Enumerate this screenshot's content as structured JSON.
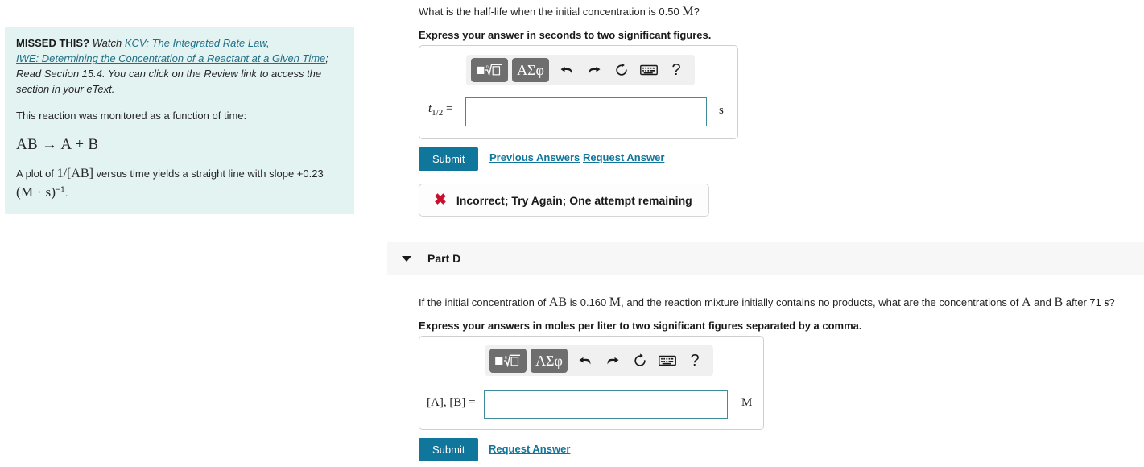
{
  "hint": {
    "missed_label": "MISSED THIS?",
    "watch_word": "Watch",
    "link1": "KCV: The Integrated Rate Law,",
    "link2": "IWE: Determining the Concentration of a Reactant at a Given Time",
    "tail": "; Read Section 15.4. You can click on the Review link to access the section in your eText.",
    "monitored_text": "This reaction was monitored as a function of time:",
    "equation": "AB → A + B",
    "plot_pre": "A plot of ",
    "plot_expr": "1/[AB]",
    "plot_mid": " versus time yields a straight line with slope +0.23 ",
    "plot_units": "(M · s)",
    "plot_units_exp": "−1",
    "plot_end": "."
  },
  "partC": {
    "question_pre": "What is the half-life when the initial concentration is 0.50 ",
    "question_unit": "M",
    "question_post": "?",
    "instruction": "Express your answer in seconds to two significant figures.",
    "toolbar": {
      "template_label": "template-button",
      "symbols_label": "ΑΣφ",
      "undo_label": "undo-icon",
      "redo_label": "redo-icon",
      "reset_label": "reset-icon",
      "keyboard_label": "keyboard-icon",
      "help_label": "?"
    },
    "answer_label_t": "t",
    "answer_label_sub": "1/2",
    "answer_label_eq": "=",
    "answer_value": "",
    "unit": "s",
    "submit_label": "Submit",
    "previous_answers_label": "Previous Answers",
    "request_answer_label": "Request Answer",
    "feedback_icon": "x-mark-icon",
    "feedback_text": "Incorrect; Try Again; One attempt remaining"
  },
  "partD": {
    "caret": "chevron-down-icon",
    "title": "Part D",
    "q_seg1": "If the initial concentration of ",
    "q_AB": "AB",
    "q_seg2": " is 0.160 ",
    "q_M": "M",
    "q_seg3": ", and the reaction mixture initially contains no products, what are the concentrations of ",
    "q_A": "A",
    "q_seg4": " and ",
    "q_B": "B",
    "q_seg5": " after 71 ",
    "q_s": "s",
    "q_seg6": "?",
    "instruction": "Express your answers in moles per liter to two significant figures separated by a comma.",
    "toolbar": {
      "template_label": "template-button",
      "symbols_label": "ΑΣφ",
      "undo_label": "undo-icon",
      "redo_label": "redo-icon",
      "reset_label": "reset-icon",
      "keyboard_label": "keyboard-icon",
      "help_label": "?"
    },
    "answer_label": "[A], [B] =",
    "answer_value": "",
    "unit": "M",
    "submit_label": "Submit",
    "request_answer_label": "Request Answer"
  },
  "colors": {
    "hint_bg": "#e3f3f2",
    "link": "#1f6f86",
    "accent": "#11769b",
    "error": "#c8102e",
    "band_bg": "#f7f7f7",
    "toolbar_btn": "#6e6e6e"
  }
}
